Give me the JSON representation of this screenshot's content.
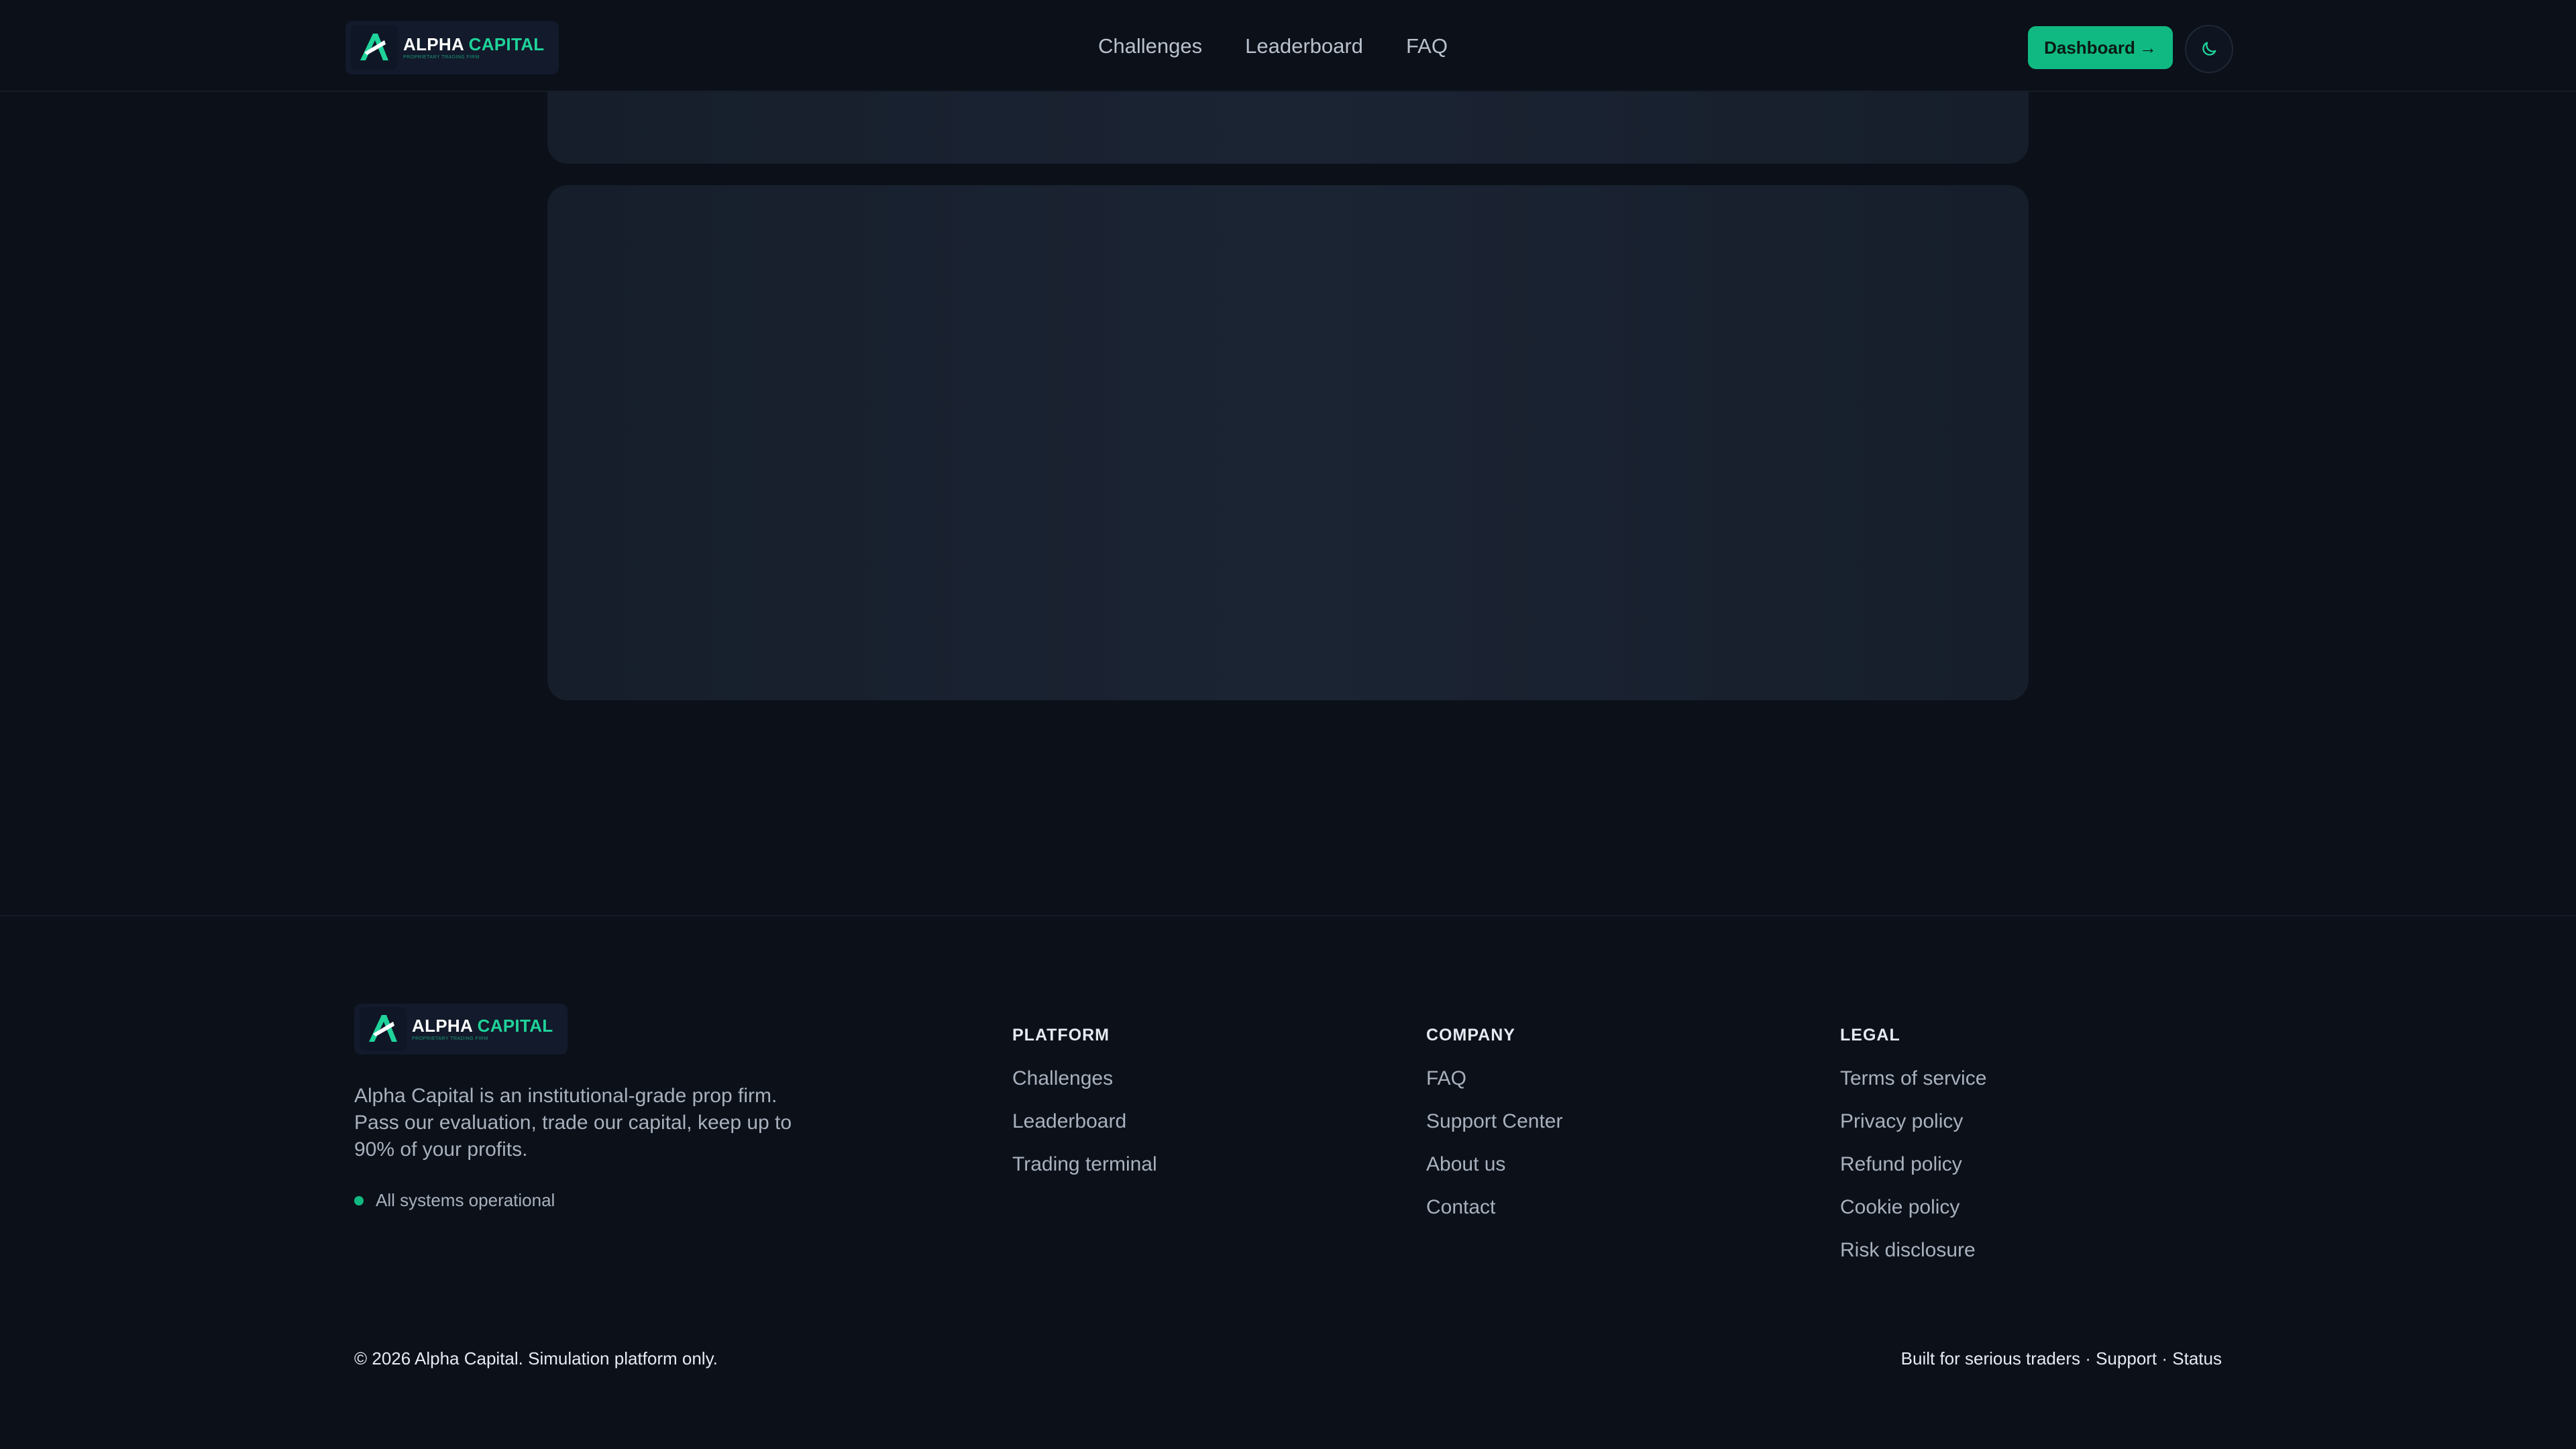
{
  "header": {
    "logo": {
      "brand_white": "ALPHA ",
      "brand_green": "CAPITAL",
      "tagline": "PROPRIETARY TRADING FIRM"
    },
    "nav": [
      {
        "label": "Challenges"
      },
      {
        "label": "Leaderboard"
      },
      {
        "label": "FAQ"
      }
    ],
    "dashboard_label": "Dashboard",
    "dashboard_arrow": "→",
    "theme_toggle_icon": "moon-icon"
  },
  "footer": {
    "logo": {
      "brand_white": "ALPHA ",
      "brand_green": "CAPITAL",
      "tagline": "PROPRIETARY TRADING FIRM"
    },
    "description": "Alpha Capital is an institutional-grade prop firm. Pass our evaluation, trade our capital, keep up to 90% of your profits.",
    "status_text": "All systems operational",
    "columns": {
      "platform": {
        "heading": "PLATFORM",
        "links": [
          "Challenges",
          "Leaderboard",
          "Trading terminal"
        ]
      },
      "company": {
        "heading": "COMPANY",
        "links": [
          "FAQ",
          "Support Center",
          "About us",
          "Contact"
        ]
      },
      "legal": {
        "heading": "LEGAL",
        "links": [
          "Terms of service",
          "Privacy policy",
          "Refund policy",
          "Cookie policy",
          "Risk disclosure"
        ]
      }
    },
    "copyright": "© 2026 Alpha Capital. Simulation platform only.",
    "bottom_right": {
      "built": "Built for serious traders",
      "sep1": " · ",
      "support": "Support",
      "sep2": " · ",
      "status": "Status"
    }
  },
  "colors": {
    "background": "#0b1019",
    "accent": "#10b981",
    "brand_green": "#1fd39a",
    "skeleton": "#1b2433"
  }
}
